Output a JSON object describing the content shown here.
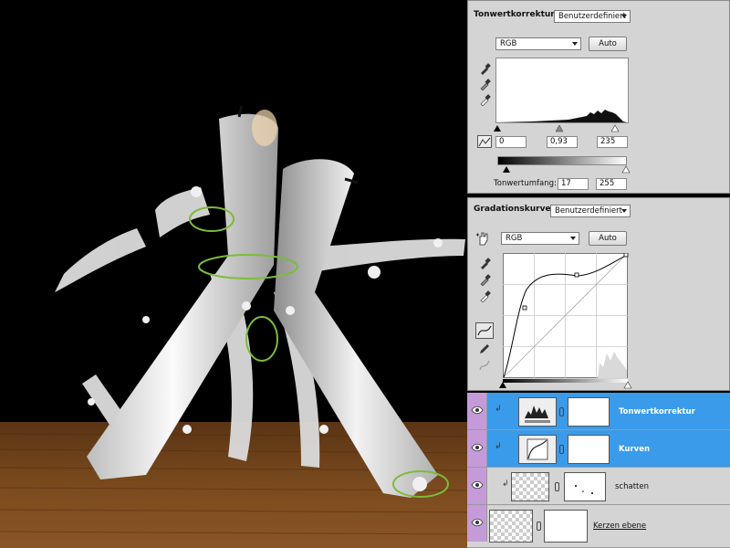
{
  "levels": {
    "title": "Tonwertkorrektur",
    "preset": "Benutzerdefiniert",
    "channel": "RGB",
    "auto_label": "Auto",
    "input_black": "0",
    "input_gamma": "0,93",
    "input_white": "235",
    "output_label": "Tonwertumfang:",
    "output_black": "17",
    "output_white": "255"
  },
  "curves": {
    "title": "Gradationskurven",
    "preset": "Benutzerdefiniert",
    "channel": "RGB",
    "auto_label": "Auto"
  },
  "layers": [
    {
      "name": "Tonwertkorrektur",
      "selected": true
    },
    {
      "name": "Kurven",
      "selected": true
    },
    {
      "name": "schatten",
      "selected": false
    },
    {
      "name": "Kerzen ebene",
      "selected": false
    }
  ],
  "colors": {
    "arrow": "#6db33f",
    "circle": "#7dbb3a",
    "selection": "#3a9bea",
    "eye_column": "#c49bd8"
  }
}
